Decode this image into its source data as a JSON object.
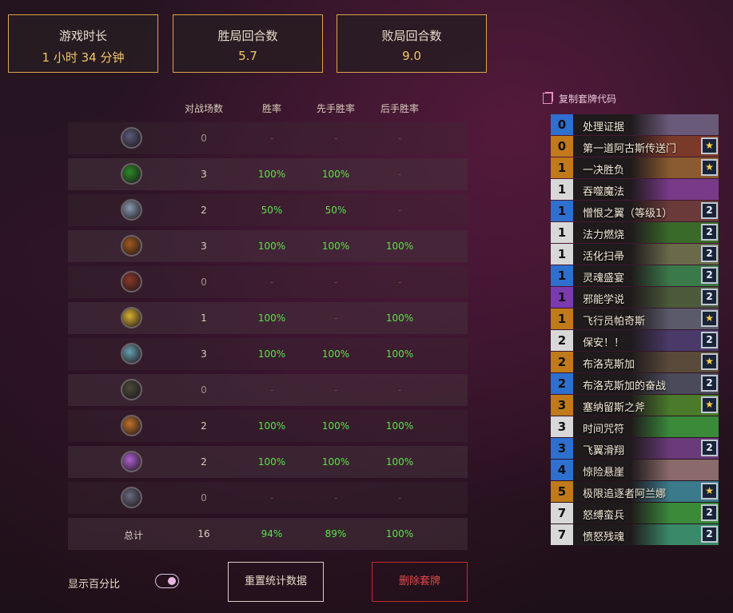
{
  "stats": [
    {
      "title": "游戏时长",
      "value": "1 小时 34 分钟"
    },
    {
      "title": "胜局回合数",
      "value": "5.7"
    },
    {
      "title": "败局回合数",
      "value": "9.0"
    }
  ],
  "table": {
    "headers": [
      "对战场数",
      "胜率",
      "先手胜率",
      "后手胜率"
    ],
    "rows": [
      {
        "icon": "class-icon-1",
        "games": "0",
        "win": "-",
        "first": "-",
        "second": "-"
      },
      {
        "icon": "class-icon-2",
        "games": "3",
        "win": "100%",
        "first": "100%",
        "second": "-"
      },
      {
        "icon": "class-icon-3",
        "games": "2",
        "win": "50%",
        "first": "50%",
        "second": "-"
      },
      {
        "icon": "class-icon-4",
        "games": "3",
        "win": "100%",
        "first": "100%",
        "second": "100%"
      },
      {
        "icon": "class-icon-5",
        "games": "0",
        "win": "-",
        "first": "-",
        "second": "-"
      },
      {
        "icon": "class-icon-6",
        "games": "1",
        "win": "100%",
        "first": "-",
        "second": "100%"
      },
      {
        "icon": "class-icon-7",
        "games": "3",
        "win": "100%",
        "first": "100%",
        "second": "100%"
      },
      {
        "icon": "class-icon-8",
        "games": "0",
        "win": "-",
        "first": "-",
        "second": "-"
      },
      {
        "icon": "class-icon-9",
        "games": "2",
        "win": "100%",
        "first": "100%",
        "second": "100%"
      },
      {
        "icon": "class-icon-10",
        "games": "2",
        "win": "100%",
        "first": "100%",
        "second": "100%"
      },
      {
        "icon": "class-icon-11",
        "games": "0",
        "win": "-",
        "first": "-",
        "second": "-"
      }
    ],
    "total": {
      "label": "总计",
      "games": "16",
      "win": "94%",
      "first": "89%",
      "second": "100%"
    }
  },
  "controls": {
    "show_percent_label": "显示百分比",
    "reset_label": "重置统计数据",
    "delete_label": "删除套牌"
  },
  "deck": {
    "copy_label": "复制套牌代码",
    "cards": [
      {
        "cost": "0",
        "name": "处理证据",
        "badge": "",
        "rarity": "common",
        "art": "#6a5a7a"
      },
      {
        "cost": "0",
        "name": "第一道阿古斯传送门",
        "badge": "★",
        "rarity": "legendary",
        "art": "#7a3a2a"
      },
      {
        "cost": "1",
        "name": "一决胜负",
        "badge": "★",
        "rarity": "legendary",
        "art": "#8a5a30"
      },
      {
        "cost": "1",
        "name": "吞噬魔法",
        "badge": "",
        "rarity": "free",
        "art": "#7a3a8a"
      },
      {
        "cost": "1",
        "name": "憎恨之翼（等级1）",
        "badge": "2",
        "rarity": "common",
        "art": "#6a3a3a"
      },
      {
        "cost": "1",
        "name": "法力燃烧",
        "badge": "2",
        "rarity": "free",
        "art": "#3a6a2a"
      },
      {
        "cost": "1",
        "name": "活化扫帚",
        "badge": "2",
        "rarity": "free",
        "art": "#6a6a4a"
      },
      {
        "cost": "1",
        "name": "灵魂盛宴",
        "badge": "2",
        "rarity": "common",
        "art": "#3a7a4a"
      },
      {
        "cost": "1",
        "name": "邪能学说",
        "badge": "2",
        "rarity": "epic",
        "art": "#4a5a3a"
      },
      {
        "cost": "1",
        "name": "飞行员帕奇斯",
        "badge": "★",
        "rarity": "legendary",
        "art": "#5a5a6a"
      },
      {
        "cost": "2",
        "name": "保安！！",
        "badge": "2",
        "rarity": "free",
        "art": "#4a3a6a"
      },
      {
        "cost": "2",
        "name": "布洛克斯加",
        "badge": "★",
        "rarity": "legendary",
        "art": "#5a4a3a"
      },
      {
        "cost": "2",
        "name": "布洛克斯加的奋战",
        "badge": "2",
        "rarity": "common",
        "art": "#4a4a5a"
      },
      {
        "cost": "3",
        "name": "塞纳留斯之斧",
        "badge": "★",
        "rarity": "legendary",
        "art": "#4a7a2a"
      },
      {
        "cost": "3",
        "name": "时间咒符",
        "badge": "",
        "rarity": "free",
        "art": "#3a8a3a"
      },
      {
        "cost": "3",
        "name": "飞翼滑翔",
        "badge": "2",
        "rarity": "common",
        "art": "#6a3a7a"
      },
      {
        "cost": "4",
        "name": "惊险悬崖",
        "badge": "",
        "rarity": "common",
        "art": "#8a6a6a"
      },
      {
        "cost": "5",
        "name": "极限追逐者阿兰娜",
        "badge": "★",
        "rarity": "legendary",
        "art": "#3a7a8a"
      },
      {
        "cost": "7",
        "name": "怒缚蛮兵",
        "badge": "2",
        "rarity": "free",
        "art": "#3a8a3a"
      },
      {
        "cost": "7",
        "name": "愤怒残魂",
        "badge": "2",
        "rarity": "free",
        "art": "#3a8a6a"
      }
    ]
  },
  "colors": {
    "gold_border": "#d9a54a",
    "win_green": "#5be34a",
    "delete_red": "#e24a4a",
    "rarity_common": "#2f6fd0",
    "rarity_legendary": "#c07a1a",
    "rarity_free": "#d8d8d8",
    "rarity_epic": "#7a3ab0"
  }
}
